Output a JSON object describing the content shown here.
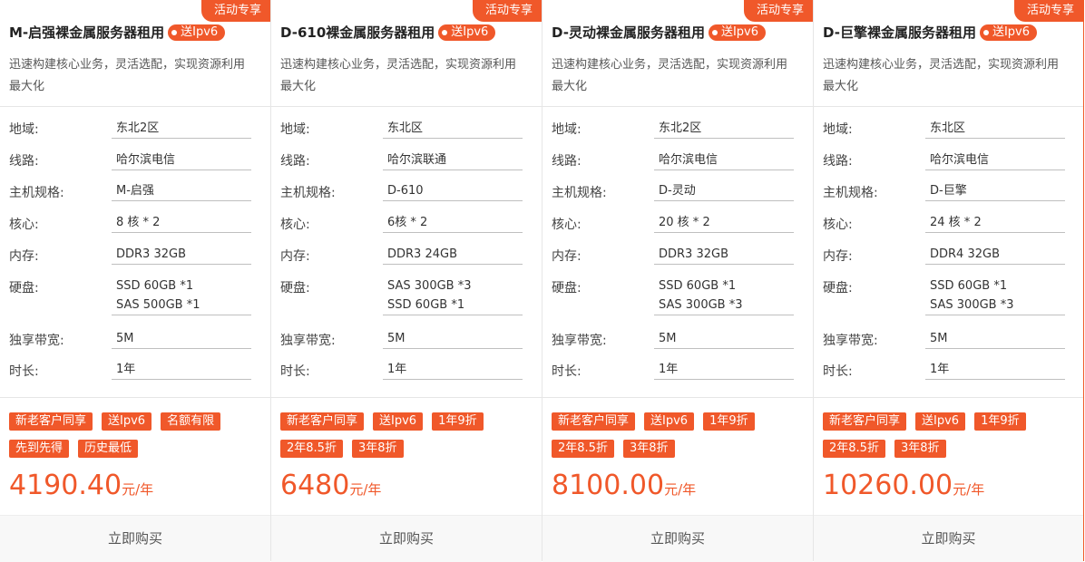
{
  "cards": [
    {
      "promo": "活动专享",
      "title": "M-启强裸金属服务器租用",
      "badge": "送Ipv6",
      "desc": "迅速构建核心业务，灵活选配，实现资源利用最大化",
      "specs": {
        "region": {
          "label": "地域:",
          "value": "东北2区"
        },
        "line": {
          "label": "线路:",
          "value": "哈尔滨电信"
        },
        "host": {
          "label": "主机规格:",
          "value": "M-启强"
        },
        "cores": {
          "label": "核心:",
          "value": "8 核 * 2"
        },
        "memory": {
          "label": "内存:",
          "value": "DDR3 32GB"
        },
        "disk": {
          "label": "硬盘:",
          "value1": "SSD 60GB *1",
          "value2": "SAS 500GB *1"
        },
        "bandwidth": {
          "label": "独享带宽:",
          "value": "5M"
        },
        "duration": {
          "label": "时长:",
          "value": "1年"
        }
      },
      "tags": [
        "新老客户同享",
        "送Ipv6",
        "名额有限",
        "先到先得",
        "历史最低"
      ],
      "price": "4190.40",
      "unit": "元/年",
      "buy": "立即购买"
    },
    {
      "promo": "活动专享",
      "title": "D-610裸金属服务器租用",
      "badge": "送Ipv6",
      "desc": "迅速构建核心业务，灵活选配，实现资源利用最大化",
      "specs": {
        "region": {
          "label": "地域:",
          "value": "东北区"
        },
        "line": {
          "label": "线路:",
          "value": "哈尔滨联通"
        },
        "host": {
          "label": "主机规格:",
          "value": "D-610"
        },
        "cores": {
          "label": "核心:",
          "value": "6核 * 2"
        },
        "memory": {
          "label": "内存:",
          "value": "DDR3 24GB"
        },
        "disk": {
          "label": "硬盘:",
          "value1": "SAS 300GB *3",
          "value2": "SSD 60GB *1"
        },
        "bandwidth": {
          "label": "独享带宽:",
          "value": "5M"
        },
        "duration": {
          "label": "时长:",
          "value": "1年"
        }
      },
      "tags": [
        "新老客户同享",
        "送Ipv6",
        "1年9折",
        "2年8.5折",
        "3年8折"
      ],
      "price": "6480",
      "unit": "元/年",
      "buy": "立即购买"
    },
    {
      "promo": "活动专享",
      "title": "D-灵动裸金属服务器租用",
      "badge": "送Ipv6",
      "desc": "迅速构建核心业务，灵活选配，实现资源利用最大化",
      "specs": {
        "region": {
          "label": "地域:",
          "value": "东北2区"
        },
        "line": {
          "label": "线路:",
          "value": "哈尔滨电信"
        },
        "host": {
          "label": "主机规格:",
          "value": "D-灵动"
        },
        "cores": {
          "label": "核心:",
          "value": "20 核 * 2"
        },
        "memory": {
          "label": "内存:",
          "value": "DDR3 32GB"
        },
        "disk": {
          "label": "硬盘:",
          "value1": "SSD 60GB *1",
          "value2": "SAS 300GB *3"
        },
        "bandwidth": {
          "label": "独享带宽:",
          "value": "5M"
        },
        "duration": {
          "label": "时长:",
          "value": "1年"
        }
      },
      "tags": [
        "新老客户同享",
        "送Ipv6",
        "1年9折",
        "2年8.5折",
        "3年8折"
      ],
      "price": "8100.00",
      "unit": "元/年",
      "buy": "立即购买"
    },
    {
      "promo": "活动专享",
      "title": "D-巨擎裸金属服务器租用",
      "badge": "送Ipv6",
      "desc": "迅速构建核心业务，灵活选配，实现资源利用最大化",
      "specs": {
        "region": {
          "label": "地域:",
          "value": "东北区"
        },
        "line": {
          "label": "线路:",
          "value": "哈尔滨电信"
        },
        "host": {
          "label": "主机规格:",
          "value": "D-巨擎"
        },
        "cores": {
          "label": "核心:",
          "value": "24 核 * 2"
        },
        "memory": {
          "label": "内存:",
          "value": "DDR4 32GB"
        },
        "disk": {
          "label": "硬盘:",
          "value1": "SSD 60GB *1",
          "value2": "SAS 300GB *3"
        },
        "bandwidth": {
          "label": "独享带宽:",
          "value": "5M"
        },
        "duration": {
          "label": "时长:",
          "value": "1年"
        }
      },
      "tags": [
        "新老客户同享",
        "送Ipv6",
        "1年9折",
        "2年8.5折",
        "3年8折"
      ],
      "price": "10260.00",
      "unit": "元/年",
      "buy": "立即购买"
    }
  ]
}
